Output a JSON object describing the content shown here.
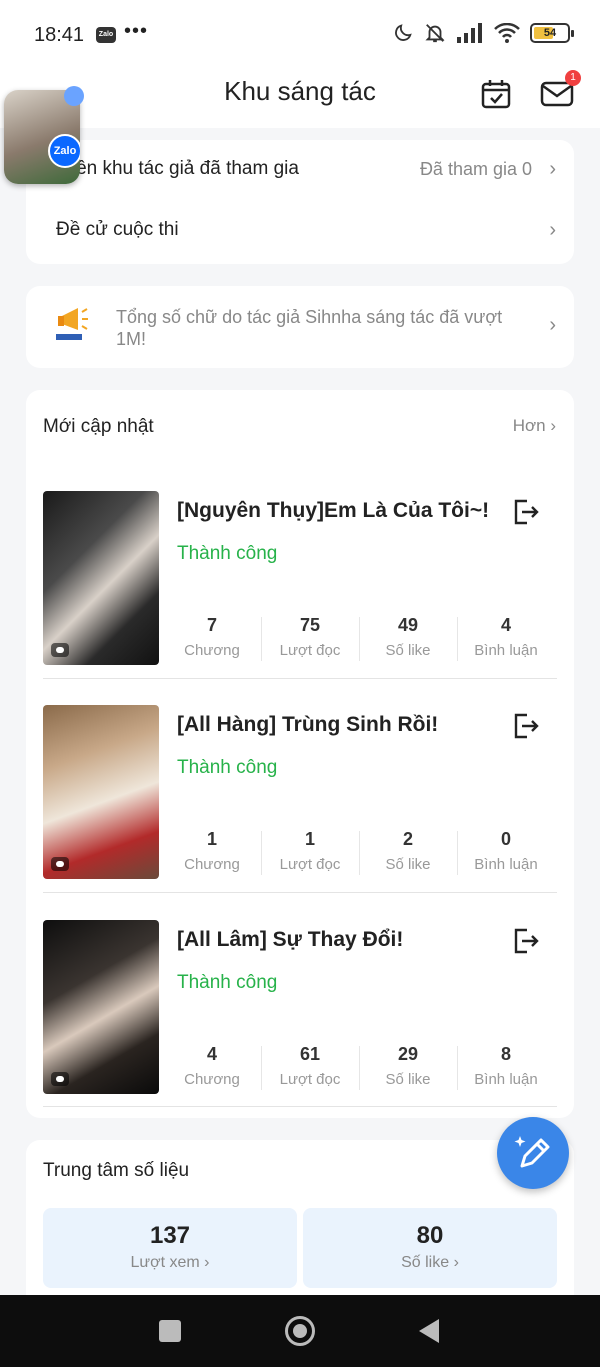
{
  "status_bar": {
    "time": "18:41",
    "zalo_badge": "Zalo",
    "more": "•••",
    "battery": "54"
  },
  "header": {
    "title": "Khu sáng tác",
    "mail_badge": "1"
  },
  "bubble": {
    "app": "Zalo"
  },
  "menu": {
    "row1_label": "uyên khu tác giả đã tham gia",
    "row1_value": "Đã tham gia 0",
    "row2_label": "Đề cử cuộc thi"
  },
  "notice": {
    "text": "Tổng số chữ do tác giả Sihnha sáng tác đã vượt 1M!"
  },
  "updates": {
    "title": "Mới cập nhật",
    "more": "Hơn",
    "stat_labels": {
      "chapters": "Chương",
      "reads": "Lượt đọc",
      "likes": "Số like",
      "comments": "Bình luận"
    },
    "books": [
      {
        "title": "[Nguyên Thụy]Em Là Của Tôi~!",
        "status": "Thành công",
        "chapters": "7",
        "reads": "75",
        "likes": "49",
        "comments": "4"
      },
      {
        "title": "[All Hàng] Trùng Sinh Rồi!",
        "status": "Thành công",
        "chapters": "1",
        "reads": "1",
        "likes": "2",
        "comments": "0"
      },
      {
        "title": "[All Lâm] Sự Thay Đổi!",
        "status": "Thành công",
        "chapters": "4",
        "reads": "61",
        "likes": "29",
        "comments": "8"
      }
    ]
  },
  "data_center": {
    "title": "Trung tâm số liệu",
    "views_value": "137",
    "views_label": "Lượt xem",
    "likes_value": "80",
    "likes_label": "Số like"
  },
  "colors": {
    "accent": "#3a86e8",
    "success": "#27b24a",
    "box": "#eaf3fd"
  }
}
